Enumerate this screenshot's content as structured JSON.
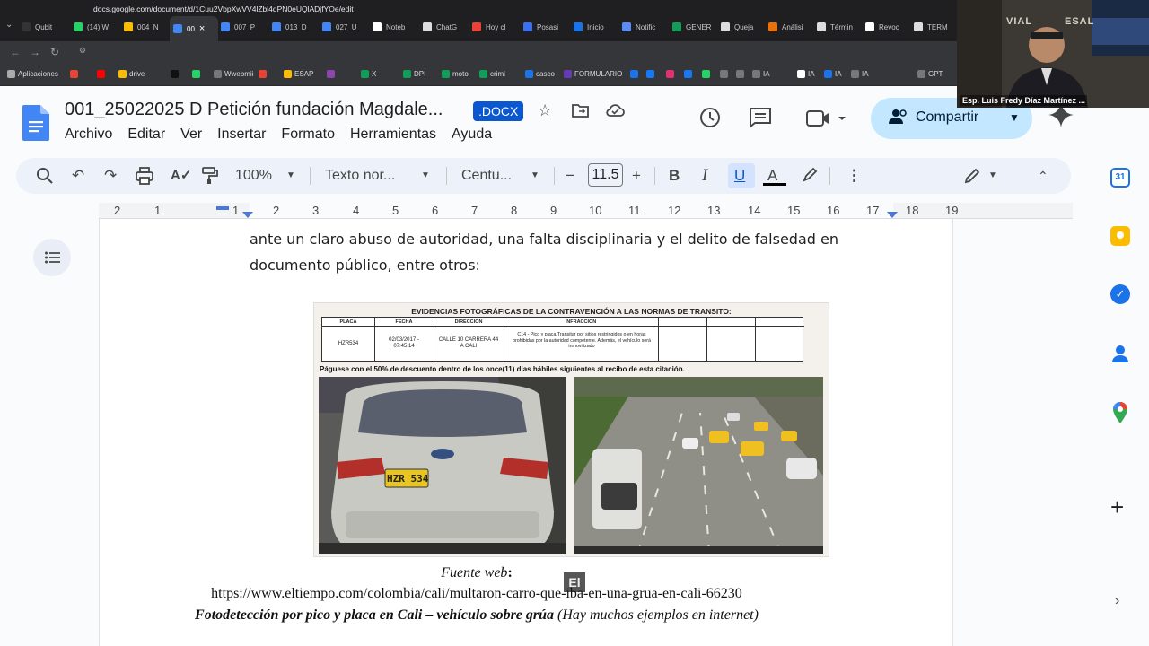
{
  "browser": {
    "tabs": [
      {
        "label": "Qubit",
        "color": "#333"
      },
      {
        "label": "(14) W",
        "color": "#25d366"
      },
      {
        "label": "004_N",
        "color": "#fbbc04"
      },
      {
        "label": "00",
        "color": "#4285f4"
      },
      {
        "label": "007_P",
        "color": "#4285f4"
      },
      {
        "label": "013_D",
        "color": "#4285f4"
      },
      {
        "label": "027_U",
        "color": "#4285f4"
      },
      {
        "label": "Noteb",
        "color": "#fff"
      },
      {
        "label": "ChatG",
        "color": "#ddd"
      },
      {
        "label": "Hoy cl",
        "color": "#ea4335"
      },
      {
        "label": "Posasi",
        "color": "#3c6ff0"
      },
      {
        "label": "Inicio",
        "color": "#1a73e8"
      },
      {
        "label": "Notific",
        "color": "#5b8cf5"
      },
      {
        "label": "GENER",
        "color": "#0f9d58"
      },
      {
        "label": "Queja",
        "color": "#ddd"
      },
      {
        "label": "Análisi",
        "color": "#e8710a"
      },
      {
        "label": "Términ",
        "color": "#ddd"
      },
      {
        "label": "Revoc",
        "color": "#fff"
      },
      {
        "label": "TERM",
        "color": "#ddd"
      }
    ],
    "url": "docs.google.com/document/d/1Cuu2VbpXwVV4lZbl4dPN0eUQlADjfYOe/edit",
    "bookmarks": [
      {
        "label": "Aplicaciones",
        "color": "#aaa"
      },
      {
        "label": "",
        "color": "#ea4335"
      },
      {
        "label": "",
        "color": "#ff0000"
      },
      {
        "label": "drive",
        "color": "#fbbc04"
      },
      {
        "label": "",
        "color": "#111"
      },
      {
        "label": "",
        "color": "#25d366"
      },
      {
        "label": "Wwebmii",
        "color": "#777"
      },
      {
        "label": "",
        "color": "#ea4335"
      },
      {
        "label": "ESAP",
        "color": "#fbbc04"
      },
      {
        "label": "",
        "color": "#8e44ad"
      },
      {
        "label": "X",
        "color": "#0f9d58"
      },
      {
        "label": "DPI",
        "color": "#0f9d58"
      },
      {
        "label": "moto",
        "color": "#0f9d58"
      },
      {
        "label": "crimi",
        "color": "#0f9d58"
      },
      {
        "label": "casco",
        "color": "#1a73e8"
      },
      {
        "label": "FORMULARIO",
        "color": "#673ab7"
      },
      {
        "label": "",
        "color": "#1a73e8"
      },
      {
        "label": "",
        "color": "#1877f2"
      },
      {
        "label": "",
        "color": "#e1306c"
      },
      {
        "label": "",
        "color": "#1877f2"
      },
      {
        "label": "",
        "color": "#25d366"
      },
      {
        "label": "",
        "color": "#777"
      },
      {
        "label": "",
        "color": "#777"
      },
      {
        "label": "IA",
        "color": "#777"
      },
      {
        "label": "IA",
        "color": "#fff"
      },
      {
        "label": "IA",
        "color": "#1a73e8"
      },
      {
        "label": "IA",
        "color": "#777"
      },
      {
        "label": "GPT",
        "color": "#777"
      }
    ]
  },
  "doc": {
    "title": "001_25022025 D Petición fundación Magdale...",
    "badge": ".DOCX",
    "menu": [
      "Archivo",
      "Editar",
      "Ver",
      "Insertar",
      "Formato",
      "Herramientas",
      "Ayuda"
    ],
    "share_label": "Compartir"
  },
  "toolbar": {
    "zoom": "100%",
    "style": "Texto nor...",
    "font": "Centu...",
    "size": "11.5"
  },
  "ruler": {
    "numbers": [
      "2",
      "1",
      "1",
      "2",
      "3",
      "4",
      "5",
      "6",
      "7",
      "8",
      "9",
      "10",
      "11",
      "12",
      "13",
      "14",
      "15",
      "16",
      "17",
      "18",
      "19"
    ]
  },
  "content": {
    "line1": "ante un claro abuso de autoridad, una falta disciplinaria y el delito de falsedad en",
    "line2": "documento público, entre otros:",
    "evidence": {
      "title": "EVIDENCIAS FOTOGRÁFICAS DE LA CONTRAVENCIÓN A LAS NORMAS DE TRANSITO:",
      "headers": [
        "PLACA",
        "FECHA",
        "DIRECCIÓN",
        "INFRACCIÓN",
        "",
        "",
        ""
      ],
      "placa": "HZR534",
      "fecha": "02/03/2017 - 07:45:14",
      "direccion": "CALLE 10 CARRERA 44 A CALI",
      "infraccion": "C14 - Pico y placa.Transitar por sitios restringidos o en horas prohibidas por la autoridad competente. Además, el vehículo será inmovilizado",
      "discount": "Páguese con el 50% de descuento dentro de los once(11) dias hábiles siguientes al recibo de esta citación.",
      "plate_text": "HZR 534"
    },
    "caption_source_label": "Fuente web",
    "caption_colon": ":",
    "caption_url": "https://www.eltiempo.com/colombia/cali/multaron-carro-que-iba-en-una-grua-en-cali-66230",
    "caption_title": "Fotodetección por pico y placa en Cali – vehículo sobre grúa",
    "caption_note": "(Hay muchos ejemplos en internet)",
    "watermark": "El"
  },
  "video": {
    "name": "Esp. Luis Fredy Díaz Martínez ...",
    "wall_text": "VIAL",
    "wall_text2": "ESAL"
  }
}
